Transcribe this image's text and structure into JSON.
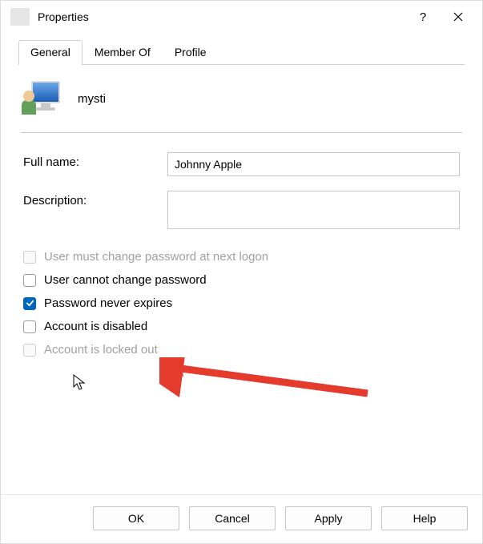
{
  "window": {
    "title": "Properties"
  },
  "tabs": [
    {
      "label": "General",
      "active": true
    },
    {
      "label": "Member Of",
      "active": false
    },
    {
      "label": "Profile",
      "active": false
    }
  ],
  "user": {
    "name": "mysti"
  },
  "fields": {
    "full_name_label": "Full name:",
    "full_name_value": "Johnny Apple",
    "description_label": "Description:",
    "description_value": ""
  },
  "checkboxes": {
    "must_change": {
      "label": "User must change password at next logon",
      "checked": false,
      "disabled": true
    },
    "cannot_change": {
      "label": "User cannot change password",
      "checked": false,
      "disabled": false
    },
    "never_expires": {
      "label": "Password never expires",
      "checked": true,
      "disabled": false
    },
    "is_disabled": {
      "label": "Account is disabled",
      "checked": false,
      "disabled": false
    },
    "locked_out": {
      "label": "Account is locked out",
      "checked": false,
      "disabled": true
    }
  },
  "buttons": {
    "ok": "OK",
    "cancel": "Cancel",
    "apply": "Apply",
    "help": "Help"
  },
  "annotation": {
    "arrow_color": "#e43b2c"
  }
}
